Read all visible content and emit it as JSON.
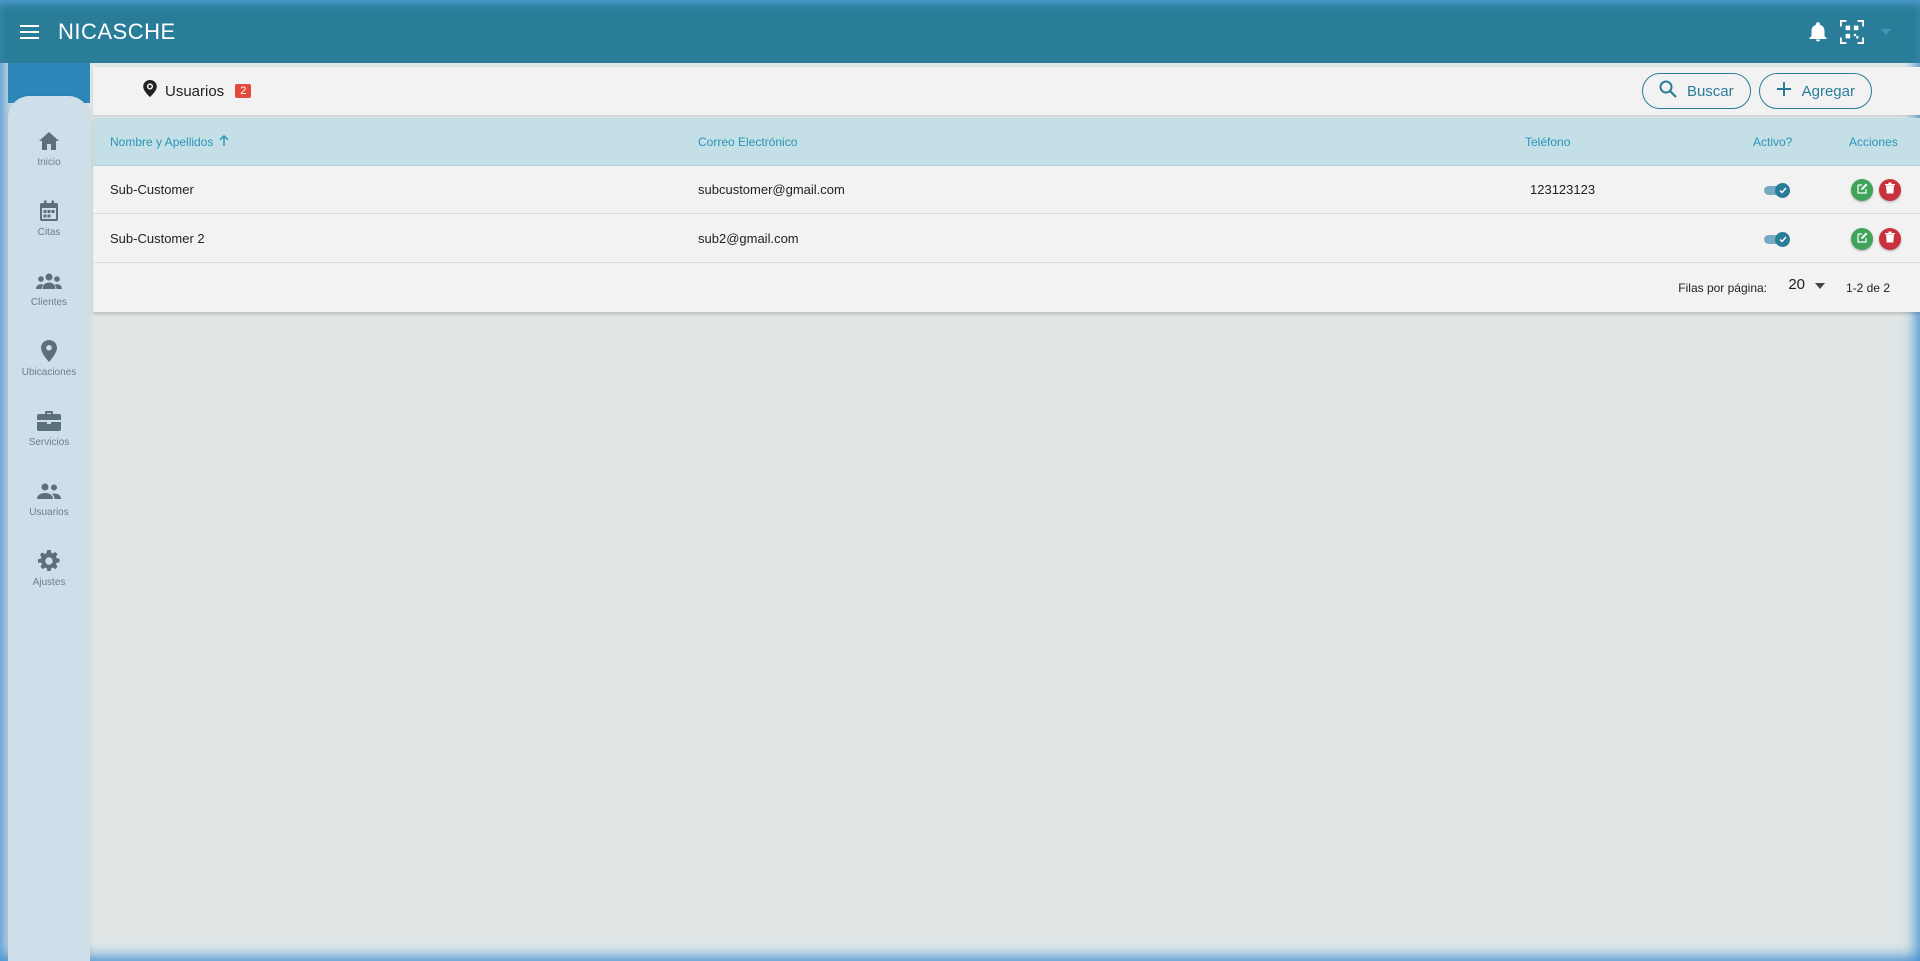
{
  "app": {
    "title": "NICASCHE"
  },
  "colors": {
    "primary": "#2a7d99",
    "accent_link": "#2a96b8",
    "badge": "#e24a3b",
    "edit": "#3fa35a",
    "delete": "#c8323c"
  },
  "topbar": {
    "icons": [
      "menu-icon",
      "bell-icon",
      "qr-scan-icon",
      "dropdown-arrow-icon"
    ]
  },
  "sidebar": {
    "items": [
      {
        "label": "Inicio",
        "icon": "home-icon"
      },
      {
        "label": "Citas",
        "icon": "calendar-icon"
      },
      {
        "label": "Clientes",
        "icon": "groups-icon"
      },
      {
        "label": "Ubicaciones",
        "icon": "location-pin-icon"
      },
      {
        "label": "Servicios",
        "icon": "briefcase-icon"
      },
      {
        "label": "Usuarios",
        "icon": "users-icon"
      },
      {
        "label": "Ajustes",
        "icon": "gear-icon"
      }
    ]
  },
  "header": {
    "title": "Usuarios",
    "count": "2",
    "search_label": "Buscar",
    "add_label": "Agregar"
  },
  "table": {
    "columns": [
      "Nombre y Apellidos",
      "Correo Electrónico",
      "Teléfono",
      "Activo?",
      "Acciones"
    ],
    "sort_column": "Nombre y Apellidos",
    "sort_direction": "ascending",
    "rows": [
      {
        "name": "Sub-Customer",
        "email": "subcustomer@gmail.com",
        "phone": "123123123",
        "active": true
      },
      {
        "name": "Sub-Customer 2",
        "email": "sub2@gmail.com",
        "phone": "",
        "active": true
      }
    ]
  },
  "pagination": {
    "rows_per_page_label": "Filas por página:",
    "rows_per_page": "20",
    "range": "1-2 de 2"
  }
}
